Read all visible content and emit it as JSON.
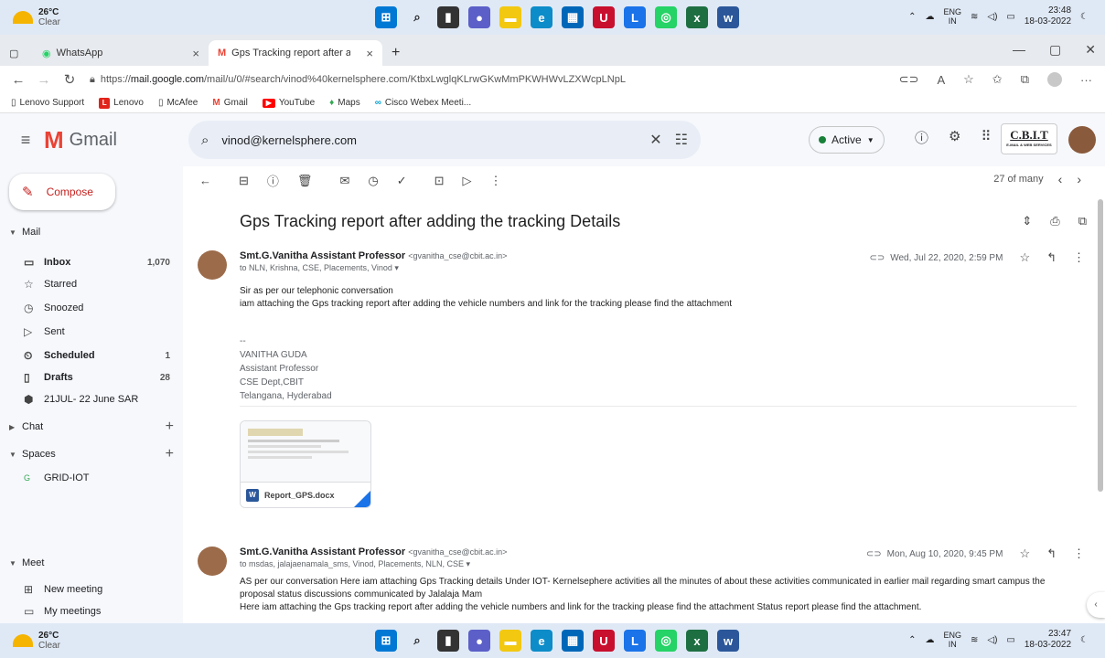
{
  "taskbar_top": {
    "temp": "26°C",
    "cond": "Clear",
    "lang1": "ENG",
    "lang2": "IN",
    "time": "23:48",
    "date": "18-03-2022"
  },
  "taskbar_bottom": {
    "temp": "26°C",
    "cond": "Clear",
    "lang1": "ENG",
    "lang2": "IN",
    "time": "23:47",
    "date": "18-03-2022"
  },
  "browser": {
    "tabs": [
      {
        "label": "WhatsApp"
      },
      {
        "label": "Gps Tracking report after adding"
      }
    ],
    "url_prefix": "https://",
    "url_host": "mail.google.com",
    "url_path": "/mail/u/0/#search/vinod%40kernelsphere.com/KtbxLwglqKLrwGKwMmPKWHWvLZXWcpLNpL",
    "bookmarks": [
      "Lenovo Support",
      "Lenovo",
      "McAfee",
      "Gmail",
      "YouTube",
      "Maps",
      "Cisco Webex Meeti..."
    ]
  },
  "gmail": {
    "logo": "Gmail",
    "search_value": "vinod@kernelsphere.com",
    "status": "Active",
    "cbit": "C.B.I.T",
    "cbit_sub": "E-MAIL & WEB SERVICES",
    "compose": "Compose",
    "sections": {
      "mail": "Mail",
      "chat": "Chat",
      "spaces": "Spaces",
      "meet": "Meet"
    },
    "nav": [
      {
        "label": "Inbox",
        "count": "1,070"
      },
      {
        "label": "Starred",
        "count": ""
      },
      {
        "label": "Snoozed",
        "count": ""
      },
      {
        "label": "Sent",
        "count": ""
      },
      {
        "label": "Scheduled",
        "count": "1"
      },
      {
        "label": "Drafts",
        "count": "28"
      },
      {
        "label": "21JUL- 22 June SAR",
        "count": ""
      }
    ],
    "space": {
      "badge": "G",
      "label": "GRID-IOT"
    },
    "meet": [
      "New meeting",
      "My meetings"
    ],
    "pager": "27 of many",
    "subject": "Gps Tracking report after adding the tracking Details",
    "messages": [
      {
        "sender": "Smt.G.Vanitha Assistant Professor",
        "email": "<gvanitha_cse@cbit.ac.in>",
        "to": "to NLN, Krishna, CSE, Placements, Vinod ▾",
        "date": "Wed, Jul 22, 2020, 2:59 PM",
        "body": [
          "Sir as per our telephonic conversation",
          "iam attaching the Gps tracking report after adding the vehicle numbers and link for the tracking please find the attachment"
        ],
        "sig": [
          "--",
          "VANITHA GUDA",
          "Assistant Professor",
          "CSE Dept,CBIT",
          "Telangana, Hyderabad"
        ],
        "attachment": "Report_GPS.docx"
      },
      {
        "sender": "Smt.G.Vanitha Assistant Professor",
        "email": "<gvanitha_cse@cbit.ac.in>",
        "to": "to msdas, jalajaenamala_sms, Vinod, Placements, NLN, CSE ▾",
        "date": "Mon, Aug 10, 2020, 9:45 PM",
        "body": [
          "AS per our conversation Here iam attaching Gps Tracking details Under IOT- Kernelsephere activities all the minutes of about these activities communicated in earlier mail regarding smart campus the",
          "proposal status discussions communicated by Jalalaja Mam",
          "Here iam attaching the Gps tracking report after adding the vehicle numbers and link for the tracking please find the attachment Status report please find the attachment."
        ]
      }
    ]
  }
}
